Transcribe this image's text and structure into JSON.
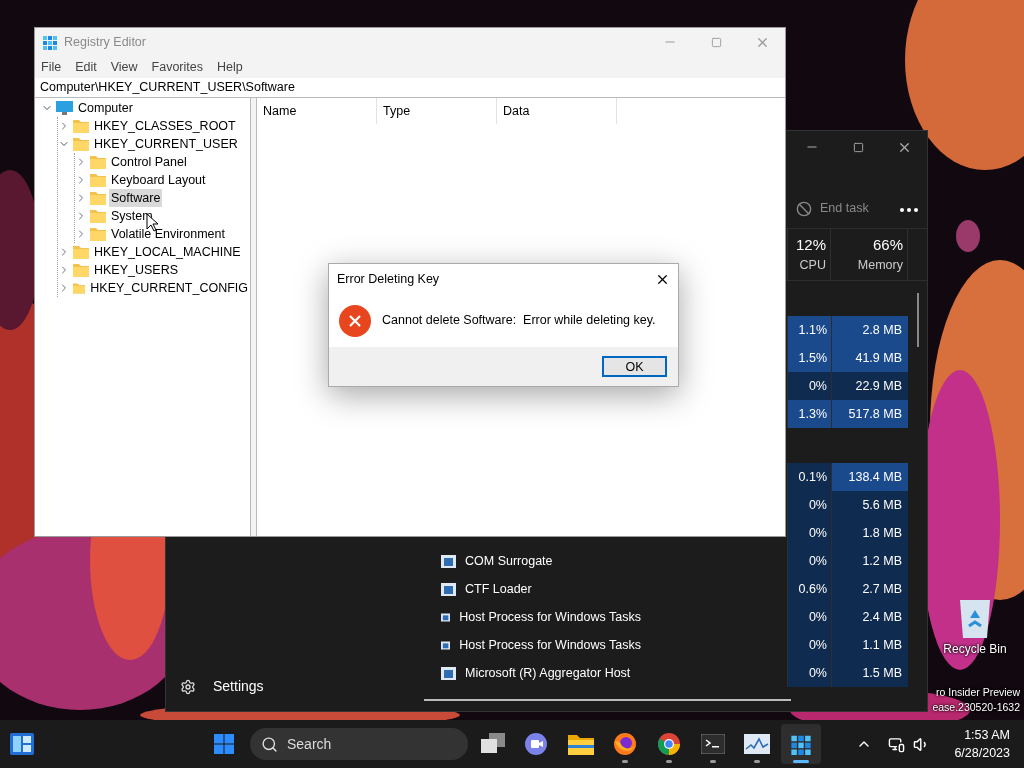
{
  "desktop": {
    "icons": [
      {
        "label": "Recycle Bin"
      }
    ],
    "watermark": [
      "ro Insider Preview",
      "ease.230520-1632"
    ]
  },
  "task_manager": {
    "end_task": {
      "label": "End task",
      "disabled": true
    },
    "columns": [
      {
        "value": "12%",
        "label": "CPU"
      },
      {
        "value": "66%",
        "label": "Memory"
      }
    ],
    "rows": [
      {
        "kind": "group"
      },
      {
        "kind": "process",
        "cpu": "1.1%",
        "memory": "2.8 MB",
        "cpu_hot": true,
        "memory_hot": true
      },
      {
        "kind": "process",
        "cpu": "1.5%",
        "memory": "41.9 MB",
        "cpu_hot": true,
        "memory_hot": true
      },
      {
        "kind": "process",
        "cpu": "0%",
        "memory": "22.9 MB",
        "cpu_hot": false,
        "memory_hot": false
      },
      {
        "kind": "process",
        "cpu": "1.3%",
        "memory": "517.8 MB",
        "cpu_hot": true,
        "memory_hot": true
      },
      {
        "kind": "group"
      },
      {
        "kind": "process",
        "cpu": "0.1%",
        "memory": "138.4 MB",
        "cpu_hot": false,
        "memory_hot": true
      },
      {
        "kind": "process",
        "cpu": "0%",
        "memory": "5.6 MB",
        "cpu_hot": false,
        "memory_hot": false
      },
      {
        "kind": "process",
        "cpu": "0%",
        "memory": "1.8 MB",
        "cpu_hot": false,
        "memory_hot": false
      },
      {
        "kind": "process",
        "name": "COM Surrogate",
        "cpu": "0%",
        "memory": "1.2 MB",
        "cpu_hot": false,
        "memory_hot": false
      },
      {
        "kind": "process",
        "name": "CTF Loader",
        "cpu": "0.6%",
        "memory": "2.7 MB",
        "cpu_hot": false,
        "memory_hot": false
      },
      {
        "kind": "process",
        "name": "Host Process for Windows Tasks",
        "cpu": "0%",
        "memory": "2.4 MB",
        "cpu_hot": false,
        "memory_hot": false
      },
      {
        "kind": "process",
        "name": "Host Process for Windows Tasks",
        "cpu": "0%",
        "memory": "1.1 MB",
        "cpu_hot": false,
        "memory_hot": false
      },
      {
        "kind": "process",
        "name": "Microsoft (R) Aggregator Host",
        "cpu": "0%",
        "memory": "1.5 MB",
        "cpu_hot": false,
        "memory_hot": false
      }
    ],
    "nav": {
      "settings": "Settings"
    }
  },
  "registry_editor": {
    "title": "Registry Editor",
    "menu": [
      "File",
      "Edit",
      "View",
      "Favorites",
      "Help"
    ],
    "address": "Computer\\HKEY_CURRENT_USER\\Software",
    "tree": [
      {
        "kind": "computer",
        "label": "Computer",
        "expanded": true,
        "selected": false,
        "children": [
          {
            "kind": "folder",
            "label": "HKEY_CLASSES_ROOT",
            "expanded": false,
            "selected": false
          },
          {
            "kind": "folder",
            "label": "HKEY_CURRENT_USER",
            "expanded": true,
            "selected": false,
            "children": [
              {
                "kind": "folder",
                "label": "Control Panel",
                "expanded": false,
                "selected": false
              },
              {
                "kind": "folder",
                "label": "Keyboard Layout",
                "expanded": false,
                "selected": false
              },
              {
                "kind": "folder",
                "label": "Software",
                "expanded": false,
                "selected": true
              },
              {
                "kind": "folder",
                "label": "System",
                "expanded": false,
                "selected": false
              },
              {
                "kind": "folder",
                "label": "Volatile Environment",
                "expanded": false,
                "selected": false
              }
            ]
          },
          {
            "kind": "folder",
            "label": "HKEY_LOCAL_MACHINE",
            "expanded": false,
            "selected": false
          },
          {
            "kind": "folder",
            "label": "HKEY_USERS",
            "expanded": false,
            "selected": false
          },
          {
            "kind": "folder",
            "label": "HKEY_CURRENT_CONFIG",
            "expanded": false,
            "selected": false
          }
        ]
      }
    ],
    "columns": [
      "Name",
      "Type",
      "Data"
    ]
  },
  "dialog": {
    "title": "Error Deleting Key",
    "message": "Cannot delete Software:  Error while deleting key.",
    "button": "OK"
  },
  "taskbar": {
    "search": {
      "placeholder": "Search"
    },
    "apps": [
      {
        "kind": "task-view",
        "running": false,
        "selected": false
      },
      {
        "kind": "chat",
        "running": false,
        "selected": false
      },
      {
        "kind": "explorer",
        "running": false,
        "selected": false
      },
      {
        "kind": "firefox",
        "running": true,
        "selected": false
      },
      {
        "kind": "chrome",
        "running": true,
        "selected": false
      },
      {
        "kind": "terminal",
        "running": true,
        "selected": false
      },
      {
        "kind": "monitor",
        "running": true,
        "selected": false
      },
      {
        "kind": "regedit",
        "running": true,
        "selected": true
      }
    ],
    "clock": {
      "time": "1:53 AM",
      "date": "6/28/2023"
    }
  }
}
